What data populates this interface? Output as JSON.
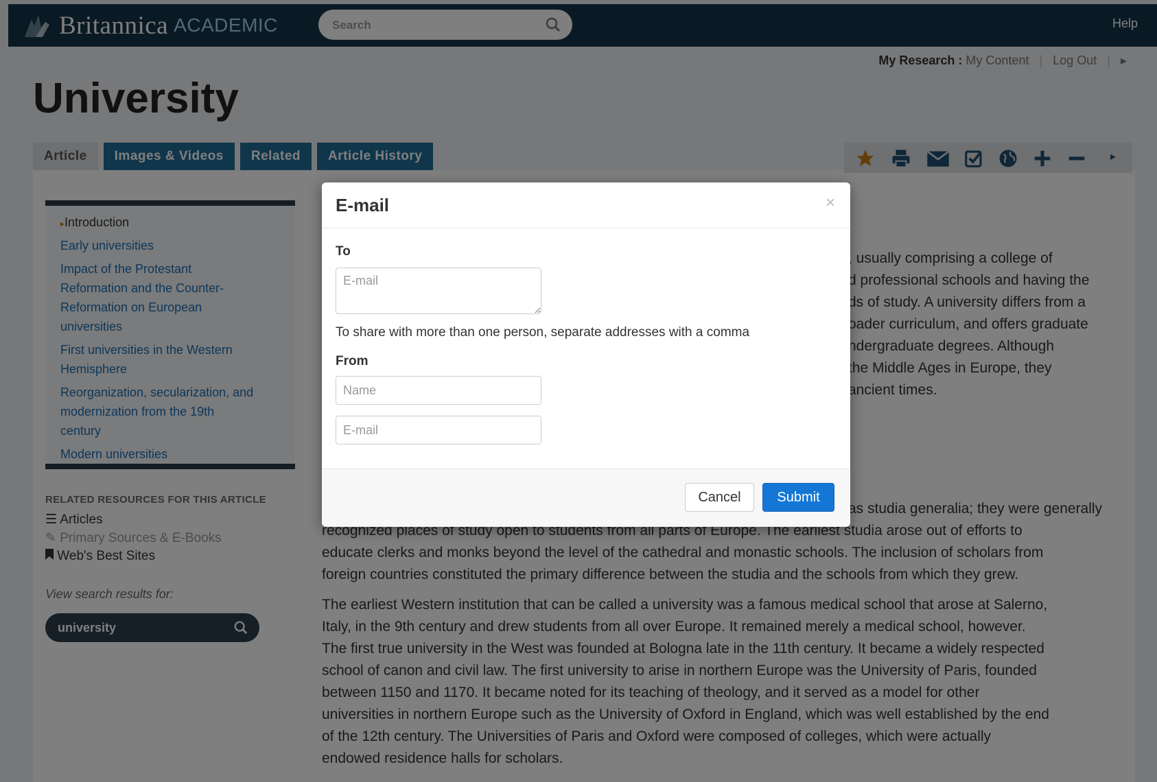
{
  "header": {
    "brand": "Britannica",
    "brand_sub": "ACADEMIC",
    "search_placeholder": "Search",
    "help": "Help"
  },
  "user_nav": {
    "my_research": "My Research",
    "colon": ":",
    "my_content": "My Content",
    "sep": "|",
    "log_out": "Log Out"
  },
  "page_title": "University",
  "tabs": [
    {
      "label": "Article"
    },
    {
      "label": "Images & Videos"
    },
    {
      "label": "Related"
    },
    {
      "label": "Article History"
    }
  ],
  "toolbar_icons": [
    "star-icon",
    "print-icon",
    "email-icon",
    "checkbox-icon",
    "globe-icon",
    "plus-icon",
    "minus-icon"
  ],
  "toc": [
    {
      "label": "Introduction"
    },
    {
      "label": "Early universities"
    },
    {
      "label": "Impact of the Protestant"
    },
    {
      "label": "Reformation and the Counter-"
    },
    {
      "label": "Reformation on European"
    },
    {
      "label": "universities"
    },
    {
      "label": "First universities in the Western"
    },
    {
      "label": "Hemisphere"
    },
    {
      "label": "Reorganization, secularization, and"
    },
    {
      "label": "modernization from the 19th"
    },
    {
      "label": "century"
    },
    {
      "label": "Modern universities"
    }
  ],
  "related": {
    "heading": "RELATED RESOURCES FOR THIS ARTICLE",
    "articles": "Articles",
    "primary_sources": "Primary Sources & E-Books",
    "web_sites": "Web's Best Sites"
  },
  "view_search": {
    "label": "View search results for:",
    "value": "university"
  },
  "article": {
    "intro_lines": [
      ", usually comprising a college of",
      "d professional schools and having the",
      "ds of study. A university differs from a",
      "oader curriculum, and offers graduate",
      "ndergraduate degrees. Although",
      " the Middle Ages in Europe, they",
      " ancient times."
    ],
    "p1_lines": [
      "as studia generalia; they were generally",
      "recognized places of study open to students from all parts of Europe. The earliest studia arose out of efforts to",
      "educate clerks and monks beyond the level of the cathedral and monastic schools. The inclusion of scholars from",
      "foreign countries constituted the primary difference between the studia and the schools from which they grew."
    ],
    "p2_lines": [
      "The earliest Western institution that can be called a university was a famous medical school that arose at Salerno,",
      "Italy, in the 9th century and drew students from all over Europe. It remained merely a medical school, however.",
      "The first true university in the West was founded at Bologna late in the 11th century. It became a widely respected",
      "school of canon and civil law. The first university to arise in northern Europe was the University of Paris, founded",
      "between 1150 and 1170. It became noted for its teaching of theology, and it served as a model for other",
      "universities in northern Europe such as the University of Oxford in England, which was well established by the end",
      "of the 12th century. The Universities of Paris and Oxford were composed of colleges, which were actually",
      "endowed residence halls for scholars."
    ]
  },
  "modal": {
    "title": "E-mail",
    "close": "×",
    "to_label": "To",
    "to_placeholder": "E-mail",
    "help_text": "To share with more than one person, separate addresses with a comma",
    "from_label": "From",
    "name_placeholder": "Name",
    "from_email_placeholder": "E-mail",
    "cancel": "Cancel",
    "submit": "Submit"
  },
  "colors": {
    "header_bg": "#153449",
    "tab_bg": "#1e6d96",
    "link": "#1a6fb5",
    "toolbar_icon": "#1e4f70",
    "star": "#c77a10",
    "submit": "#1477d6"
  }
}
